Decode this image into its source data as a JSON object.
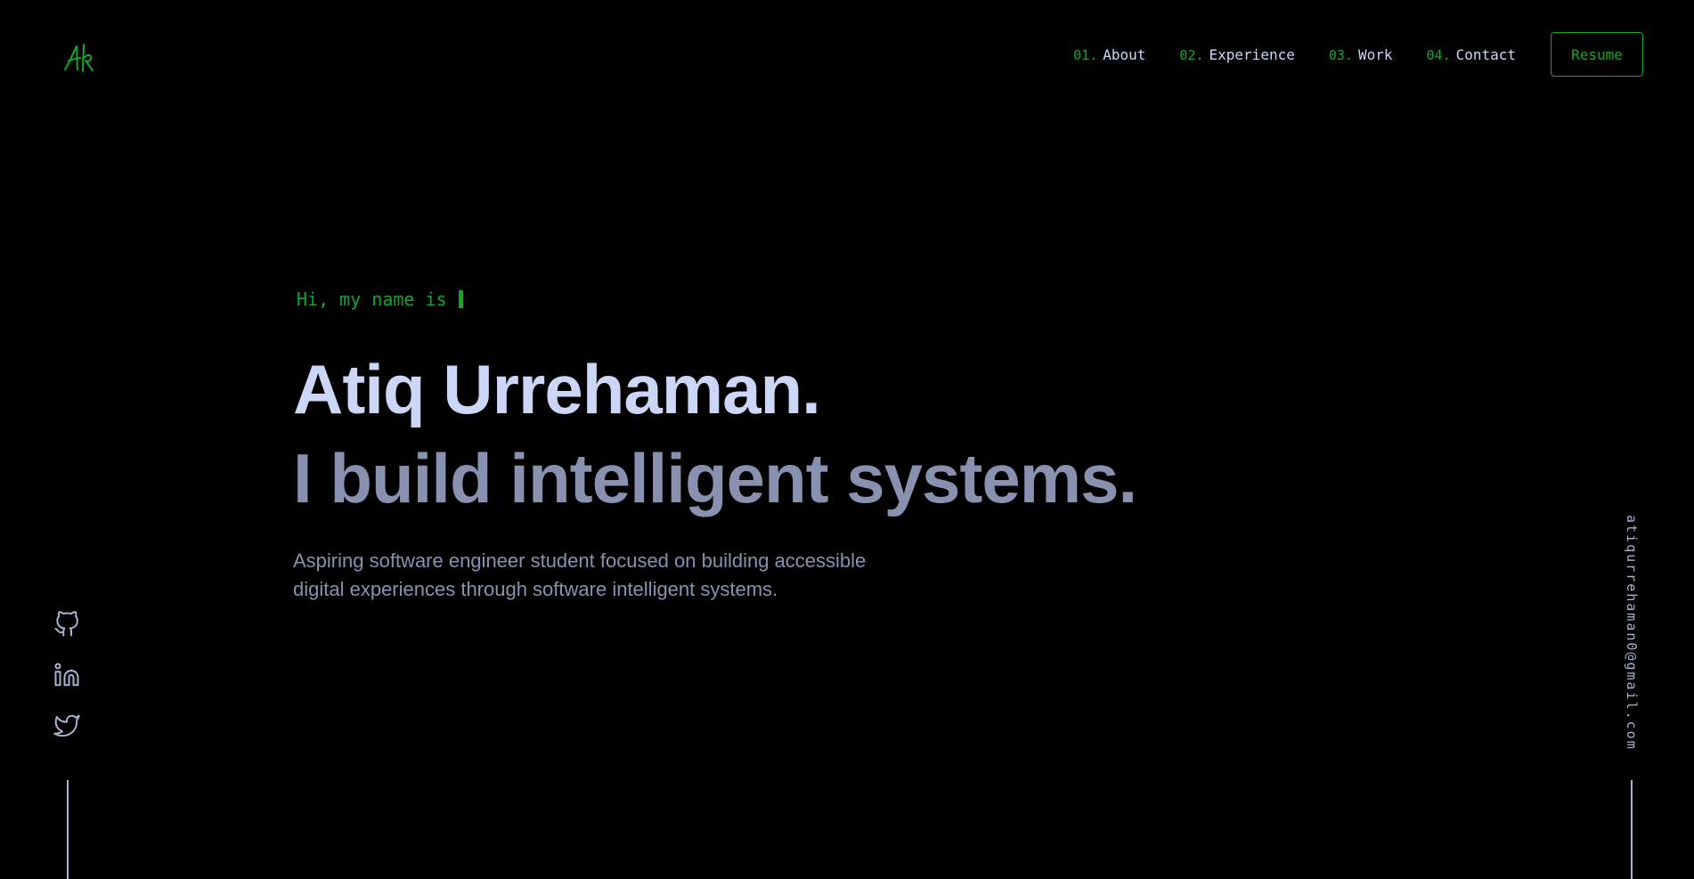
{
  "theme": {
    "accent": "#11a82a",
    "background": "#000000",
    "heading": "#ccd6f6",
    "muted": "#8892b0"
  },
  "header": {
    "logo_icon": "signature-logo-icon",
    "nav": [
      {
        "num": "01.",
        "label": "About"
      },
      {
        "num": "02.",
        "label": "Experience"
      },
      {
        "num": "03.",
        "label": "Work"
      },
      {
        "num": "04.",
        "label": "Contact"
      }
    ],
    "resume_label": "Resume"
  },
  "hero": {
    "intro": "Hi, my name is",
    "name": "Atiq Urrehaman.",
    "tagline": "I build intelligent systems.",
    "description": "Aspiring software engineer student focused on building accessible digital experiences through software intelligent systems."
  },
  "social": {
    "icons": [
      "github-icon",
      "linkedin-icon",
      "twitter-icon"
    ]
  },
  "email": "atiqurrehaman0@gmail.com"
}
